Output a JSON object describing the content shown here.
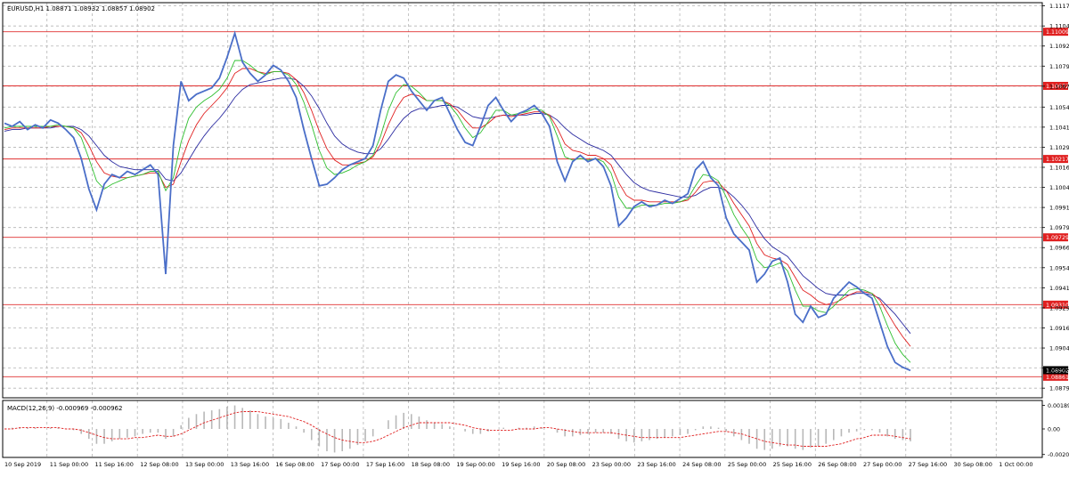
{
  "header": {
    "symbol_info": "EURUSD,H1  1.08871 1.08932 1.08857 1.08902",
    "macd_label": "MACD(12,26,9) -0.000969 -0.000962"
  },
  "colors": {
    "background": "#ffffff",
    "grid": "#b4b4b4",
    "price_line": "#4a6ec8",
    "ma_fast": "#2fbf2f",
    "ma_mid": "#e02020",
    "ma_slow": "#2a2aa0",
    "level_line": "#e03030",
    "level_label_bg": "#e02020",
    "macd_hist": "#b8b8b8",
    "macd_signal": "#e02020",
    "axis_text": "#000000"
  },
  "chart_data": {
    "type": "line",
    "title": "EURUSD,H1",
    "ohlc_last": {
      "open": 1.08871,
      "high": 1.08932,
      "low": 1.08857,
      "close": 1.08902
    },
    "price_axis": {
      "ylim": [
        1.0873,
        1.1119
      ],
      "ticks": [
        "1.11170",
        "1.11045",
        "1.10920",
        "1.10795",
        "1.10670",
        "1.10540",
        "1.10415",
        "1.10290",
        "1.10165",
        "1.10040",
        "1.09915",
        "1.09790",
        "1.09665",
        "1.09540",
        "1.09415",
        "1.09290",
        "1.09165",
        "1.09040",
        "1.08915",
        "1.08790"
      ],
      "tick_values": [
        1.1117,
        1.11045,
        1.1092,
        1.10795,
        1.1067,
        1.1054,
        1.10415,
        1.1029,
        1.10165,
        1.1004,
        1.09915,
        1.0979,
        1.09665,
        1.0954,
        1.09415,
        1.0929,
        1.09165,
        1.0904,
        1.08915,
        1.0879
      ]
    },
    "horizontal_levels": [
      {
        "value": 1.11009,
        "label": "1.11009"
      },
      {
        "value": 1.10672,
        "label": "1.10672"
      },
      {
        "value": 1.10217,
        "label": "1.10217"
      },
      {
        "value": 1.09729,
        "label": "1.09729"
      },
      {
        "value": 1.0931,
        "label": "1.09310"
      },
      {
        "value": 1.08861,
        "label": "1.08861"
      }
    ],
    "current_price": {
      "value": 1.08902,
      "label": "1.08902"
    },
    "time_axis": {
      "labels": [
        "10 Sep 2019",
        "11 Sep 00:00",
        "11 Sep 16:00",
        "12 Sep 08:00",
        "13 Sep 00:00",
        "13 Sep 16:00",
        "16 Sep 08:00",
        "17 Sep 00:00",
        "17 Sep 16:00",
        "18 Sep 08:00",
        "19 Sep 00:00",
        "19 Sep 16:00",
        "20 Sep 08:00",
        "23 Sep 00:00",
        "23 Sep 16:00",
        "24 Sep 08:00",
        "25 Sep 00:00",
        "25 Sep 16:00",
        "26 Sep 08:00",
        "27 Sep 00:00",
        "27 Sep 16:00",
        "30 Sep 08:00",
        "1 Oct 00:00"
      ]
    },
    "price_series": [
      1.1044,
      1.1042,
      1.1045,
      1.104,
      1.1043,
      1.1041,
      1.1046,
      1.1044,
      1.104,
      1.1035,
      1.1022,
      1.1003,
      1.099,
      1.1006,
      1.1012,
      1.101,
      1.1014,
      1.1012,
      1.1015,
      1.1018,
      1.1012,
      1.095,
      1.103,
      1.107,
      1.1058,
      1.1062,
      1.1064,
      1.1066,
      1.1072,
      1.1085,
      1.11,
      1.1082,
      1.1075,
      1.107,
      1.1074,
      1.108,
      1.1077,
      1.107,
      1.106,
      1.104,
      1.1022,
      1.1005,
      1.1006,
      1.101,
      1.1015,
      1.1018,
      1.102,
      1.1022,
      1.103,
      1.1052,
      1.107,
      1.1074,
      1.1072,
      1.1064,
      1.1058,
      1.1052,
      1.1058,
      1.106,
      1.105,
      1.104,
      1.1032,
      1.103,
      1.1042,
      1.1055,
      1.106,
      1.1052,
      1.1045,
      1.105,
      1.1052,
      1.1055,
      1.105,
      1.1042,
      1.102,
      1.1008,
      1.102,
      1.1024,
      1.102,
      1.1022,
      1.1017,
      1.1005,
      1.098,
      1.0985,
      1.0992,
      1.0995,
      1.0992,
      1.0993,
      1.0996,
      1.0994,
      1.0997,
      1.1,
      1.1015,
      1.102,
      1.101,
      1.1005,
      1.0985,
      1.0975,
      1.097,
      1.0965,
      1.0945,
      1.095,
      1.0958,
      1.096,
      1.0945,
      1.0925,
      1.092,
      1.093,
      1.0923,
      1.0925,
      1.0935,
      1.094,
      1.0945,
      1.0942,
      1.0938,
      1.0935,
      1.092,
      1.0905,
      1.0895,
      1.0892,
      1.089
    ],
    "ma_fast": [
      1.1041,
      1.1042,
      1.1042,
      1.1042,
      1.1042,
      1.1042,
      1.1042,
      1.1043,
      1.1042,
      1.1041,
      1.1035,
      1.1022,
      1.1008,
      1.1003,
      1.1006,
      1.1008,
      1.101,
      1.1011,
      1.1012,
      1.1014,
      1.1014,
      1.1002,
      1.101,
      1.1032,
      1.1047,
      1.1054,
      1.1058,
      1.1061,
      1.1065,
      1.1072,
      1.1083,
      1.1083,
      1.108,
      1.1076,
      1.1074,
      1.1076,
      1.1076,
      1.1074,
      1.1068,
      1.1057,
      1.1043,
      1.1027,
      1.1016,
      1.1012,
      1.1013,
      1.1015,
      1.1018,
      1.102,
      1.1024,
      1.1036,
      1.1052,
      1.1063,
      1.1068,
      1.1067,
      1.1063,
      1.1058,
      1.1058,
      1.1058,
      1.1055,
      1.1049,
      1.1041,
      1.1035,
      1.1038,
      1.1045,
      1.1052,
      1.1052,
      1.1049,
      1.105,
      1.1051,
      1.1053,
      1.1052,
      1.1048,
      1.1036,
      1.1023,
      1.1021,
      1.1022,
      1.1021,
      1.1022,
      1.102,
      1.1013,
      1.0998,
      1.0991,
      1.0991,
      1.0993,
      1.0993,
      1.0993,
      1.0994,
      1.0994,
      1.0995,
      1.0997,
      1.1005,
      1.1012,
      1.1011,
      1.1008,
      1.0998,
      1.0987,
      1.0979,
      1.0972,
      1.0959,
      1.0954,
      1.0955,
      1.0957,
      1.0952,
      1.094,
      1.093,
      1.093,
      1.0927,
      1.0926,
      1.093,
      1.0935,
      1.094,
      1.0941,
      1.094,
      1.0938,
      1.093,
      1.0918,
      1.0907,
      1.09,
      1.0895
    ],
    "ma_mid": [
      1.104,
      1.1041,
      1.1041,
      1.1041,
      1.1041,
      1.1041,
      1.1042,
      1.1042,
      1.1042,
      1.1041,
      1.1038,
      1.103,
      1.102,
      1.1013,
      1.1011,
      1.101,
      1.101,
      1.1011,
      1.1012,
      1.1013,
      1.1013,
      1.1004,
      1.1006,
      1.102,
      1.1033,
      1.1043,
      1.105,
      1.1055,
      1.106,
      1.1066,
      1.1075,
      1.1078,
      1.1078,
      1.1076,
      1.1075,
      1.1076,
      1.1076,
      1.1075,
      1.1071,
      1.1063,
      1.1052,
      1.1039,
      1.1028,
      1.1021,
      1.1018,
      1.1018,
      1.1019,
      1.102,
      1.1023,
      1.1031,
      1.1043,
      1.1053,
      1.106,
      1.1062,
      1.1061,
      1.1058,
      1.1058,
      1.1058,
      1.1056,
      1.1052,
      1.1046,
      1.1041,
      1.1041,
      1.1044,
      1.1048,
      1.1049,
      1.1048,
      1.1049,
      1.105,
      1.1051,
      1.1051,
      1.1049,
      1.1041,
      1.1031,
      1.1027,
      1.1026,
      1.1024,
      1.1024,
      1.1022,
      1.1018,
      1.1007,
      1.0999,
      1.0996,
      1.0996,
      1.0995,
      1.0995,
      1.0995,
      1.0995,
      1.0995,
      1.0996,
      1.1001,
      1.1007,
      1.1008,
      1.1007,
      1.1002,
      1.0994,
      1.0987,
      1.098,
      1.0969,
      1.0962,
      1.096,
      1.0959,
      1.0956,
      1.0948,
      1.094,
      1.0937,
      1.0933,
      1.0931,
      1.0932,
      1.0934,
      1.0937,
      1.0939,
      1.0939,
      1.0938,
      1.0934,
      1.0926,
      1.0918,
      1.0911,
      1.0905
    ],
    "ma_slow": [
      1.1039,
      1.104,
      1.104,
      1.1041,
      1.1041,
      1.1041,
      1.1041,
      1.1042,
      1.1042,
      1.1042,
      1.104,
      1.1036,
      1.103,
      1.1024,
      1.102,
      1.1017,
      1.1016,
      1.1015,
      1.1015,
      1.1015,
      1.1015,
      1.1009,
      1.1008,
      1.1013,
      1.1021,
      1.1029,
      1.1036,
      1.1042,
      1.1047,
      1.1053,
      1.106,
      1.1065,
      1.1068,
      1.1069,
      1.107,
      1.1071,
      1.1072,
      1.1072,
      1.1071,
      1.1067,
      1.1061,
      1.1053,
      1.1044,
      1.1036,
      1.1031,
      1.1028,
      1.1026,
      1.1025,
      1.1025,
      1.1028,
      1.1034,
      1.1041,
      1.1047,
      1.1051,
      1.1053,
      1.1053,
      1.1054,
      1.1055,
      1.1055,
      1.1054,
      1.1051,
      1.1048,
      1.1047,
      1.1047,
      1.1048,
      1.1049,
      1.1049,
      1.1049,
      1.1049,
      1.105,
      1.105,
      1.1049,
      1.1046,
      1.1041,
      1.1037,
      1.1034,
      1.1031,
      1.1029,
      1.1027,
      1.1024,
      1.1018,
      1.1012,
      1.1007,
      1.1004,
      1.1002,
      1.1001,
      1.1,
      1.0999,
      1.0998,
      1.0998,
      1.0999,
      1.1002,
      1.1004,
      1.1004,
      1.1002,
      1.0998,
      1.0993,
      1.0987,
      1.0979,
      1.0972,
      1.0967,
      1.0964,
      1.0961,
      1.0955,
      1.0949,
      1.0945,
      1.0941,
      1.0938,
      1.0937,
      1.0937,
      1.0937,
      1.0938,
      1.0938,
      1.0937,
      1.0935,
      1.093,
      1.0925,
      1.0919,
      1.0913
    ],
    "macd": {
      "ticks": [
        "0.001899",
        "0.00",
        "-0.002065"
      ],
      "tick_values": [
        0.001899,
        0.0,
        -0.002065
      ],
      "ylim": [
        -0.0023,
        0.0023
      ],
      "histogram": [
        0.0,
        0.0001,
        0.0001,
        0.0001,
        0.0001,
        0.0,
        0.0001,
        0.0001,
        0.0,
        -0.0001,
        -0.0004,
        -0.0008,
        -0.0012,
        -0.0012,
        -0.001,
        -0.0008,
        -0.0007,
        -0.0006,
        -0.0004,
        -0.0003,
        -0.0003,
        -0.0008,
        -0.0006,
        0.0003,
        0.0009,
        0.0012,
        0.0014,
        0.0015,
        0.0016,
        0.0018,
        0.0019,
        0.0017,
        0.0015,
        0.0012,
        0.001,
        0.0009,
        0.0008,
        0.0005,
        0.0002,
        -0.0003,
        -0.0009,
        -0.0014,
        -0.0018,
        -0.0019,
        -0.0018,
        -0.0016,
        -0.0013,
        -0.001,
        -0.0006,
        0.0,
        0.0007,
        0.0011,
        0.0013,
        0.0012,
        0.001,
        0.0007,
        0.0005,
        0.0004,
        0.0002,
        0.0,
        -0.0002,
        -0.0004,
        -0.0004,
        -0.0002,
        0.0,
        0.0001,
        0.0,
        0.0001,
        0.0001,
        0.0002,
        0.0001,
        0.0,
        -0.0003,
        -0.0006,
        -0.0006,
        -0.0005,
        -0.0004,
        -0.0003,
        -0.0003,
        -0.0004,
        -0.0008,
        -0.001,
        -0.0011,
        -0.001,
        -0.0009,
        -0.0008,
        -0.0007,
        -0.0006,
        -0.0005,
        -0.0004,
        -0.0001,
        0.0002,
        0.0002,
        0.0001,
        -0.0002,
        -0.0006,
        -0.0009,
        -0.0012,
        -0.0016,
        -0.0017,
        -0.0016,
        -0.0014,
        -0.0014,
        -0.0016,
        -0.0017,
        -0.0015,
        -0.0014,
        -0.0012,
        -0.0009,
        -0.0006,
        -0.0003,
        -0.0002,
        -0.0001,
        -0.0001,
        -0.0003,
        -0.0006,
        -0.0008,
        -0.0009,
        -0.001
      ],
      "signal": [
        0.0,
        0.0,
        0.0001,
        0.0001,
        0.0001,
        0.0001,
        0.0001,
        0.0001,
        0.0,
        0.0,
        -0.0001,
        -0.0003,
        -0.0005,
        -0.0007,
        -0.0008,
        -0.0008,
        -0.0008,
        -0.0007,
        -0.0007,
        -0.0006,
        -0.0005,
        -0.0006,
        -0.0006,
        -0.0004,
        -0.0001,
        0.0002,
        0.0005,
        0.0007,
        0.0009,
        0.0011,
        0.0013,
        0.0014,
        0.0014,
        0.0014,
        0.0013,
        0.0012,
        0.0011,
        0.001,
        0.0008,
        0.0006,
        0.0003,
        -0.0001,
        -0.0004,
        -0.0007,
        -0.0009,
        -0.001,
        -0.0011,
        -0.0011,
        -0.001,
        -0.0008,
        -0.0005,
        -0.0002,
        0.0001,
        0.0003,
        0.0005,
        0.0005,
        0.0005,
        0.0005,
        0.0005,
        0.0004,
        0.0003,
        0.0001,
        0.0,
        -0.0001,
        -0.0001,
        -0.0001,
        -0.0001,
        0.0,
        0.0,
        0.0,
        0.0001,
        0.0001,
        0.0,
        -0.0001,
        -0.0002,
        -0.0003,
        -0.0003,
        -0.0003,
        -0.0003,
        -0.0003,
        -0.0004,
        -0.0005,
        -0.0006,
        -0.0007,
        -0.0007,
        -0.0007,
        -0.0007,
        -0.0007,
        -0.0007,
        -0.0006,
        -0.0005,
        -0.0004,
        -0.0003,
        -0.0002,
        -0.0002,
        -0.0003,
        -0.0004,
        -0.0006,
        -0.0008,
        -0.001,
        -0.0011,
        -0.0012,
        -0.0013,
        -0.0013,
        -0.0014,
        -0.0014,
        -0.0014,
        -0.0014,
        -0.0013,
        -0.0012,
        -0.001,
        -0.0008,
        -0.0007,
        -0.0005,
        -0.0005,
        -0.0005,
        -0.0006,
        -0.0007,
        -0.0008
      ]
    }
  }
}
